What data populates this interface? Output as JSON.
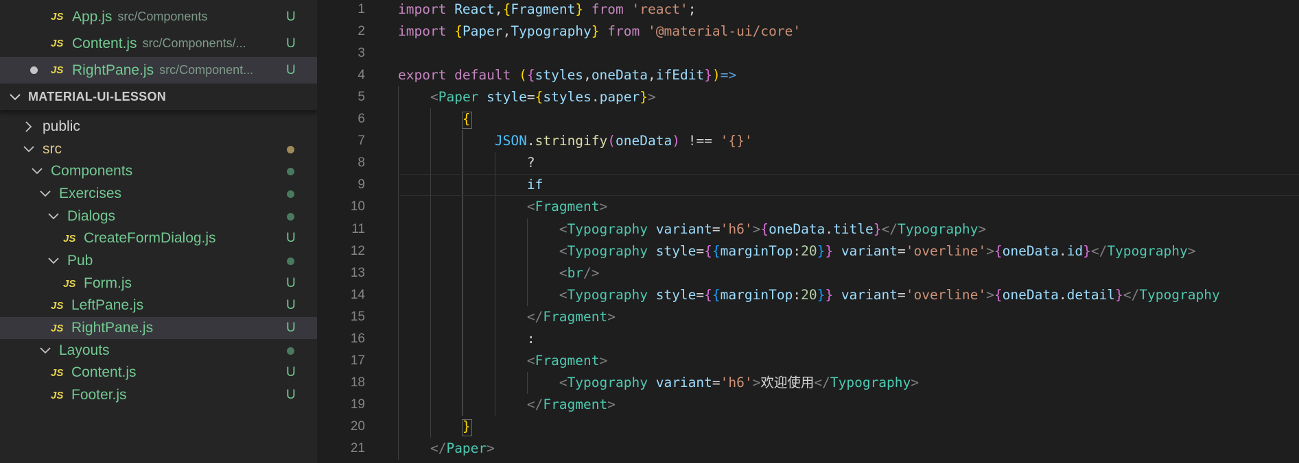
{
  "open_editors": [
    {
      "name": "App.js",
      "path": "src/Components",
      "status": "U",
      "active": false,
      "dirty": false
    },
    {
      "name": "Content.js",
      "path": "src/Components/...",
      "status": "U",
      "active": false,
      "dirty": false
    },
    {
      "name": "RightPane.js",
      "path": "src/Component...",
      "status": "U",
      "active": true,
      "dirty": true
    }
  ],
  "explorer": {
    "section_title": "MATERIAL-UI-LESSON",
    "js_badge": "JS",
    "tree": [
      {
        "label": "public",
        "type": "folder",
        "expanded": false,
        "depth": 0,
        "color": "folder"
      },
      {
        "label": "src",
        "type": "folder",
        "expanded": true,
        "depth": 0,
        "color": "mod",
        "dot": "#a08a5a"
      },
      {
        "label": "Components",
        "type": "folder",
        "expanded": true,
        "depth": 1,
        "color": "green",
        "dot": "#4a7a5e"
      },
      {
        "label": "Exercises",
        "type": "folder",
        "expanded": true,
        "depth": 2,
        "color": "green",
        "dot": "#4a7a5e"
      },
      {
        "label": "Dialogs",
        "type": "folder",
        "expanded": true,
        "depth": 3,
        "color": "green",
        "dot": "#4a7a5e"
      },
      {
        "label": "CreateFormDialog.js",
        "type": "file",
        "depth": 4,
        "color": "green",
        "status": "U"
      },
      {
        "label": "Pub",
        "type": "folder",
        "expanded": true,
        "depth": 3,
        "color": "green",
        "dot": "#4a7a5e"
      },
      {
        "label": "Form.js",
        "type": "file",
        "depth": 4,
        "color": "green",
        "status": "U"
      },
      {
        "label": "LeftPane.js",
        "type": "file",
        "depth": 3,
        "color": "green",
        "status": "U"
      },
      {
        "label": "RightPane.js",
        "type": "file",
        "depth": 3,
        "color": "green",
        "status": "U",
        "active": true
      },
      {
        "label": "Layouts",
        "type": "folder",
        "expanded": true,
        "depth": 2,
        "color": "green",
        "dot": "#4a7a5e"
      },
      {
        "label": "Content.js",
        "type": "file",
        "depth": 3,
        "color": "green",
        "status": "U"
      },
      {
        "label": "Footer.js",
        "type": "file",
        "depth": 3,
        "color": "green",
        "status": "U"
      }
    ]
  },
  "editor": {
    "current_line": 9,
    "lines": [
      {
        "n": "1",
        "t": [
          [
            "kw",
            "import "
          ],
          [
            "vr",
            "React"
          ],
          [
            "pu",
            ","
          ],
          [
            "by",
            "{"
          ],
          [
            "vr",
            "Fragment"
          ],
          [
            "by",
            "}"
          ],
          [
            "kw",
            " from "
          ],
          [
            "st",
            "'react'"
          ],
          [
            "pu",
            ";"
          ]
        ]
      },
      {
        "n": "2",
        "t": [
          [
            "kw",
            "import "
          ],
          [
            "by",
            "{"
          ],
          [
            "vr",
            "Paper"
          ],
          [
            "pu",
            ","
          ],
          [
            "vr",
            "Typography"
          ],
          [
            "by",
            "}"
          ],
          [
            "kw",
            " from "
          ],
          [
            "st",
            "'@material-ui/core'"
          ]
        ]
      },
      {
        "n": "3",
        "t": []
      },
      {
        "n": "4",
        "t": [
          [
            "kw",
            "export default "
          ],
          [
            "by",
            "("
          ],
          [
            "bk",
            "{"
          ],
          [
            "vr",
            "styles"
          ],
          [
            "pu",
            ","
          ],
          [
            "vr",
            "oneData"
          ],
          [
            "pu",
            ","
          ],
          [
            "vr",
            "ifEdit"
          ],
          [
            "bk",
            "}"
          ],
          [
            "by",
            ")"
          ],
          [
            "ar",
            "=>"
          ]
        ]
      },
      {
        "n": "5",
        "t": [
          [
            "tx",
            "    "
          ],
          [
            "gr",
            "<"
          ],
          [
            "tg",
            "Paper"
          ],
          [
            "vr",
            " style"
          ],
          [
            "pu",
            "="
          ],
          [
            "by",
            "{"
          ],
          [
            "vr",
            "styles"
          ],
          [
            "pu",
            "."
          ],
          [
            "vr",
            "paper"
          ],
          [
            "by",
            "}"
          ],
          [
            "gr",
            ">"
          ]
        ]
      },
      {
        "n": "6",
        "t": [
          [
            "tx",
            "        "
          ],
          [
            "by",
            "{"
          ]
        ]
      },
      {
        "n": "7",
        "t": [
          [
            "tx",
            "            "
          ],
          [
            "cn",
            "JSON"
          ],
          [
            "pu",
            "."
          ],
          [
            "fn",
            "stringify"
          ],
          [
            "bk",
            "("
          ],
          [
            "vr",
            "oneData"
          ],
          [
            "bk",
            ")"
          ],
          [
            "pu",
            " !== "
          ],
          [
            "st",
            "'{}'"
          ]
        ]
      },
      {
        "n": "8",
        "t": [
          [
            "tx",
            "                "
          ],
          [
            "pu",
            "?"
          ]
        ]
      },
      {
        "n": "9",
        "t": [
          [
            "tx",
            "                "
          ],
          [
            "vr",
            "if"
          ]
        ]
      },
      {
        "n": "10",
        "t": [
          [
            "tx",
            "                "
          ],
          [
            "gr",
            "<"
          ],
          [
            "tg",
            "Fragment"
          ],
          [
            "gr",
            ">"
          ]
        ]
      },
      {
        "n": "11",
        "t": [
          [
            "tx",
            "                    "
          ],
          [
            "gr",
            "<"
          ],
          [
            "tg",
            "Typography"
          ],
          [
            "vr",
            " variant"
          ],
          [
            "pu",
            "="
          ],
          [
            "st",
            "'h6'"
          ],
          [
            "gr",
            ">"
          ],
          [
            "bk",
            "{"
          ],
          [
            "vr",
            "oneData"
          ],
          [
            "pu",
            "."
          ],
          [
            "vr",
            "title"
          ],
          [
            "bk",
            "}"
          ],
          [
            "gr",
            "</"
          ],
          [
            "tg",
            "Typography"
          ],
          [
            "gr",
            ">"
          ]
        ]
      },
      {
        "n": "12",
        "t": [
          [
            "tx",
            "                    "
          ],
          [
            "gr",
            "<"
          ],
          [
            "tg",
            "Typography"
          ],
          [
            "vr",
            " style"
          ],
          [
            "pu",
            "="
          ],
          [
            "bk",
            "{"
          ],
          [
            "bb",
            "{"
          ],
          [
            "vr",
            "marginTop"
          ],
          [
            "pu",
            ":"
          ],
          [
            "nm",
            "20"
          ],
          [
            "bb",
            "}"
          ],
          [
            "bk",
            "}"
          ],
          [
            "vr",
            " variant"
          ],
          [
            "pu",
            "="
          ],
          [
            "st",
            "'overline'"
          ],
          [
            "gr",
            ">"
          ],
          [
            "bk",
            "{"
          ],
          [
            "vr",
            "oneData"
          ],
          [
            "pu",
            "."
          ],
          [
            "vr",
            "id"
          ],
          [
            "bk",
            "}"
          ],
          [
            "gr",
            "</"
          ],
          [
            "tg",
            "Typography"
          ],
          [
            "gr",
            ">"
          ]
        ]
      },
      {
        "n": "13",
        "t": [
          [
            "tx",
            "                    "
          ],
          [
            "gr",
            "<"
          ],
          [
            "tg",
            "br"
          ],
          [
            "gr",
            "/>"
          ]
        ]
      },
      {
        "n": "14",
        "t": [
          [
            "tx",
            "                    "
          ],
          [
            "gr",
            "<"
          ],
          [
            "tg",
            "Typography"
          ],
          [
            "vr",
            " style"
          ],
          [
            "pu",
            "="
          ],
          [
            "bk",
            "{"
          ],
          [
            "bb",
            "{"
          ],
          [
            "vr",
            "marginTop"
          ],
          [
            "pu",
            ":"
          ],
          [
            "nm",
            "20"
          ],
          [
            "bb",
            "}"
          ],
          [
            "bk",
            "}"
          ],
          [
            "vr",
            " variant"
          ],
          [
            "pu",
            "="
          ],
          [
            "st",
            "'overline'"
          ],
          [
            "gr",
            ">"
          ],
          [
            "bk",
            "{"
          ],
          [
            "vr",
            "oneData"
          ],
          [
            "pu",
            "."
          ],
          [
            "vr",
            "detail"
          ],
          [
            "bk",
            "}"
          ],
          [
            "gr",
            "</"
          ],
          [
            "tg",
            "Typography"
          ]
        ]
      },
      {
        "n": "15",
        "t": [
          [
            "tx",
            "                "
          ],
          [
            "gr",
            "</"
          ],
          [
            "tg",
            "Fragment"
          ],
          [
            "gr",
            ">"
          ]
        ]
      },
      {
        "n": "16",
        "t": [
          [
            "tx",
            "                "
          ],
          [
            "pu",
            ":"
          ]
        ]
      },
      {
        "n": "17",
        "t": [
          [
            "tx",
            "                "
          ],
          [
            "gr",
            "<"
          ],
          [
            "tg",
            "Fragment"
          ],
          [
            "gr",
            ">"
          ]
        ]
      },
      {
        "n": "18",
        "t": [
          [
            "tx",
            "                    "
          ],
          [
            "gr",
            "<"
          ],
          [
            "tg",
            "Typography"
          ],
          [
            "vr",
            " variant"
          ],
          [
            "pu",
            "="
          ],
          [
            "st",
            "'h6'"
          ],
          [
            "gr",
            ">"
          ],
          [
            "tx",
            "欢迎使用"
          ],
          [
            "gr",
            "</"
          ],
          [
            "tg",
            "Typography"
          ],
          [
            "gr",
            ">"
          ]
        ]
      },
      {
        "n": "19",
        "t": [
          [
            "tx",
            "                "
          ],
          [
            "gr",
            "</"
          ],
          [
            "tg",
            "Fragment"
          ],
          [
            "gr",
            ">"
          ]
        ]
      },
      {
        "n": "20",
        "t": [
          [
            "tx",
            "        "
          ],
          [
            "by",
            "}"
          ]
        ]
      },
      {
        "n": "21",
        "t": [
          [
            "tx",
            "    "
          ],
          [
            "gr",
            "</"
          ],
          [
            "tg",
            "Paper"
          ],
          [
            "gr",
            ">"
          ]
        ]
      }
    ]
  }
}
